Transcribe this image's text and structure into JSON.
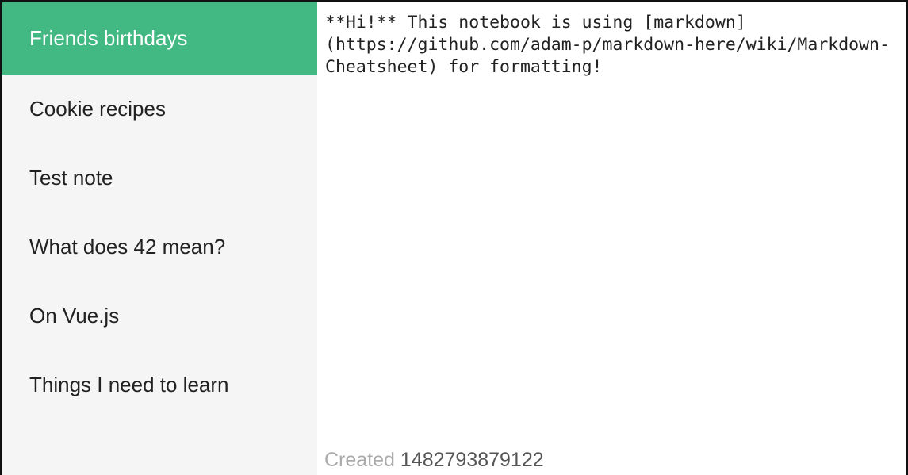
{
  "colors": {
    "accent": "#42b983",
    "sidebar_bg": "#f5f5f5"
  },
  "notes": [
    {
      "title": "Friends birthdays",
      "selected": true
    },
    {
      "title": "Cookie recipes",
      "selected": false
    },
    {
      "title": "Test note",
      "selected": false
    },
    {
      "title": "What does 42 mean?",
      "selected": false
    },
    {
      "title": "On Vue.js",
      "selected": false
    },
    {
      "title": "Things I need to learn",
      "selected": false
    }
  ],
  "editor": {
    "content": "**Hi!** This notebook is using [markdown](https://github.com/adam-p/markdown-here/wiki/Markdown-Cheatsheet) for formatting!"
  },
  "status": {
    "created_label": "Created",
    "created_value": "1482793879122"
  }
}
